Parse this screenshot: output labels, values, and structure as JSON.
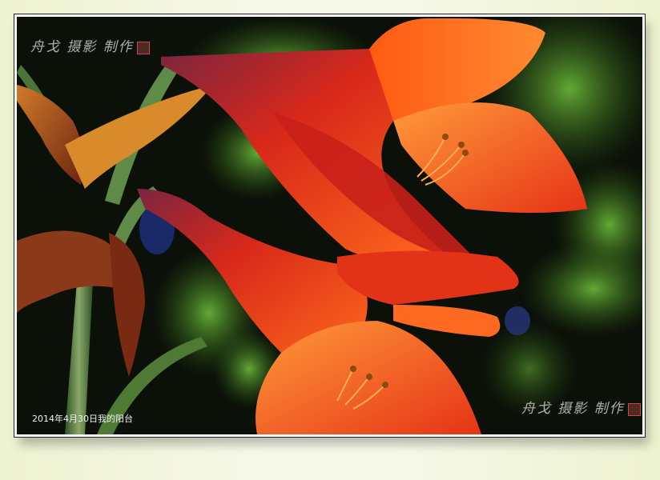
{
  "watermark_top": "舟戈 摄影 制作",
  "watermark_bottom": "舟戈 摄影 制作",
  "caption": "2014年4月30日我的阳台",
  "colors": {
    "frame": "#eef3d6",
    "petal_main": "#e8321a",
    "petal_light": "#ff7a2a",
    "stem": "#5f8a48",
    "foliage": "#3f8a2a",
    "background": "#0b1108"
  }
}
